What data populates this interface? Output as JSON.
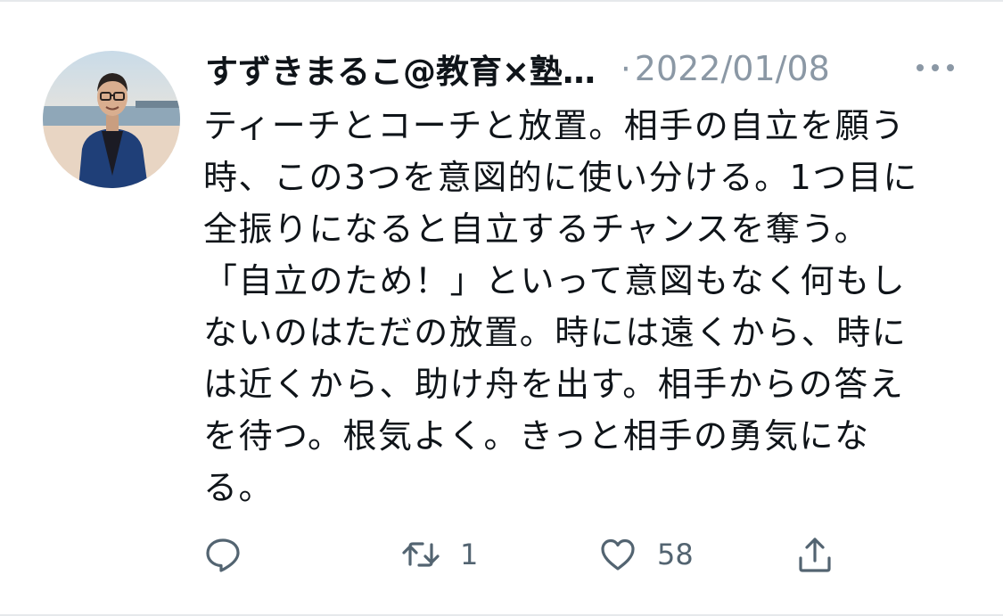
{
  "tweet": {
    "author": {
      "display_name": "すずきまるこ@教育×塾…",
      "avatar": "profile-photo"
    },
    "separator": "·",
    "date": "2022/01/08",
    "more_icon": "more-horizontal-icon",
    "text_lines": [
      "ティーチとコーチと放置。相手の自立を願う",
      "時、この3つを意図的に使い分ける。1つ目に",
      "全振りになると自立するチャンスを奪う。",
      "「自立のため！」といって意図もなく何もし",
      "ないのはただの放置。時には遠くから、時に",
      "は近くから、助け舟を出す。相手からの答え",
      "を待つ。根気よく。きっと相手の勇気にな",
      "る。"
    ],
    "actions": {
      "reply": {
        "icon": "reply-icon",
        "count": ""
      },
      "retweet": {
        "icon": "retweet-icon",
        "count": "1"
      },
      "like": {
        "icon": "heart-icon",
        "count": "58"
      },
      "share": {
        "icon": "share-icon",
        "count": ""
      }
    },
    "colors": {
      "text": "#0f1419",
      "secondary": "#8b98a5",
      "icon": "#536471",
      "border": "#e6e9eb"
    }
  }
}
